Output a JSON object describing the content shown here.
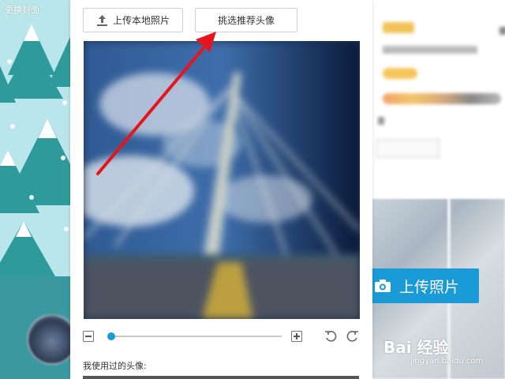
{
  "cover": {
    "label": "更换封面"
  },
  "dialog": {
    "upload_local_label": "上传本地照片",
    "recommend_label": "挑选推荐头像",
    "used_avatars_label": "我使用过的头像:",
    "zoom": {
      "level": 0.02
    }
  },
  "profile": {
    "upload_photo_label": "上传照片"
  },
  "watermark": {
    "brand": "Bai  经验",
    "sub": "jingyan.baidu.com"
  },
  "colors": {
    "accent": "#1b9ad8",
    "arrow": "#e8141c"
  },
  "icons": [
    "upload-icon",
    "zoom-out-icon",
    "zoom-in-icon",
    "rotate-left-icon",
    "rotate-right-icon",
    "camera-icon"
  ]
}
